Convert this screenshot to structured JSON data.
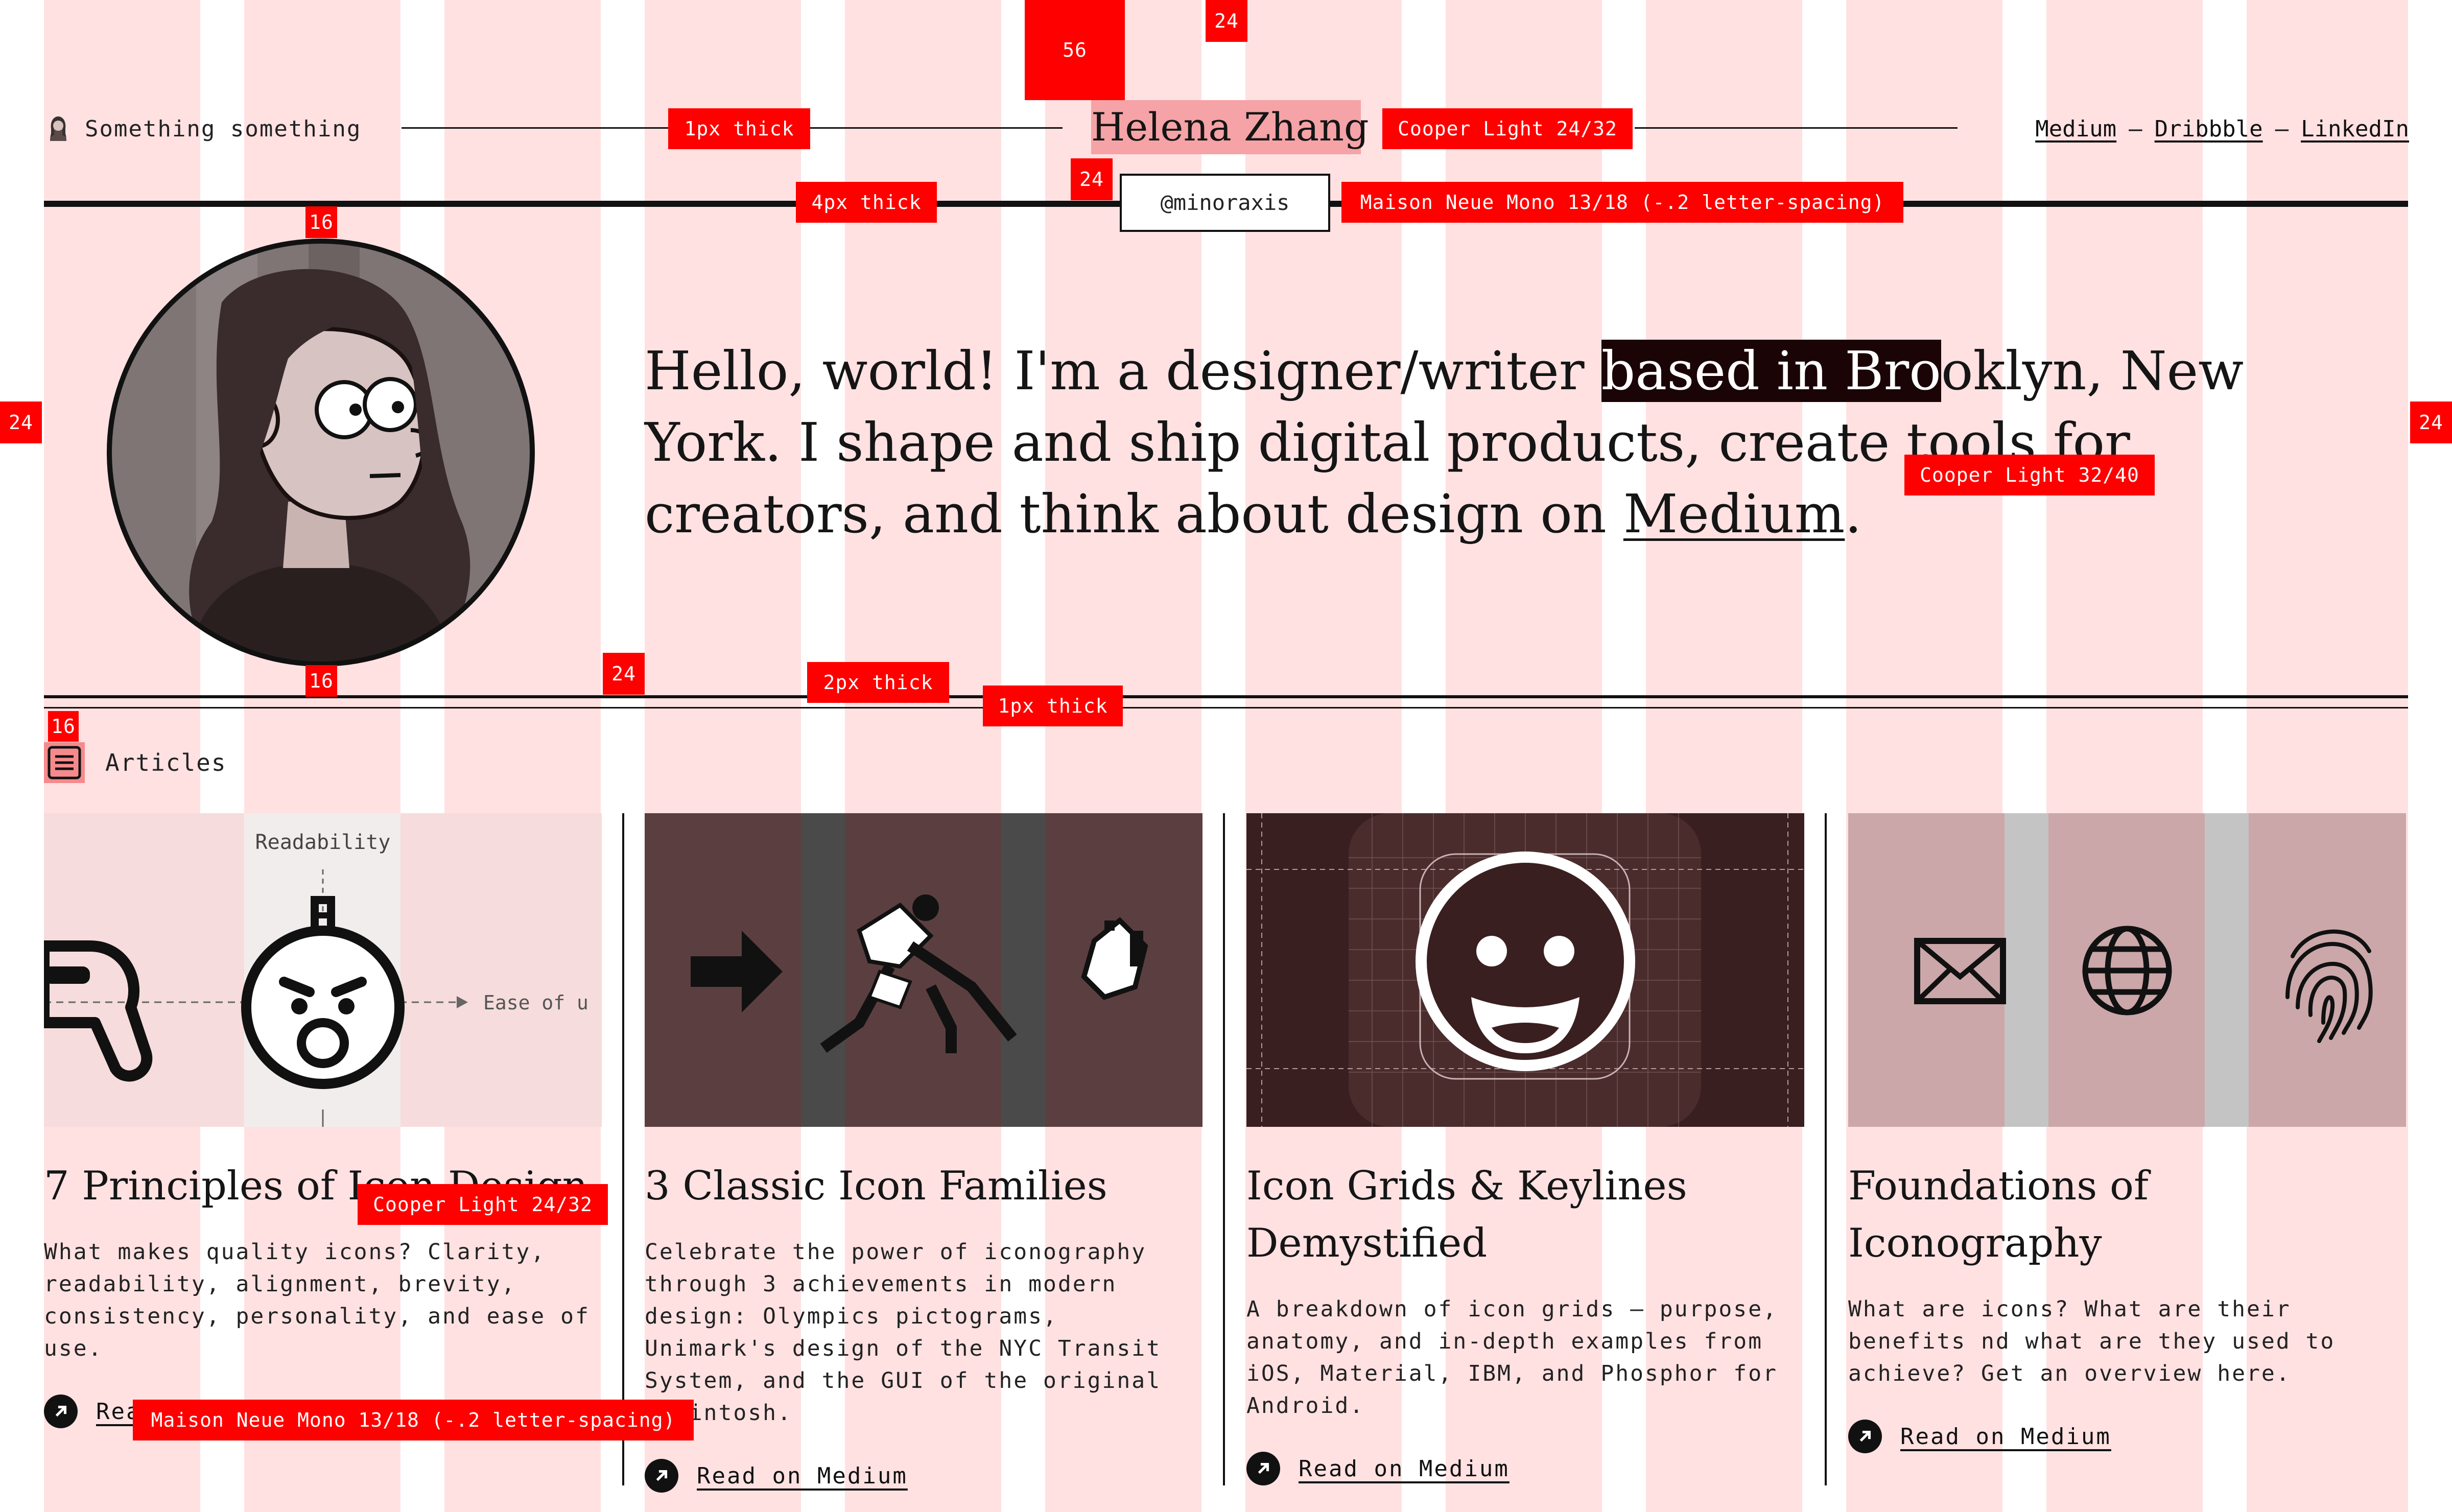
{
  "colors": {
    "grid_column": "#ffe1e2",
    "accent_red": "#ff0000",
    "title_highlight": "#f5a3a6",
    "ink": "#111111",
    "thumb_family": "#5b3f40",
    "thumb_grids": "#3a1f20",
    "thumb_foundations": "#cba7a9"
  },
  "header": {
    "brand_icon": "avatar-icon",
    "tagline": "Something something",
    "title": "Helena Zhang",
    "handle": "@minoraxis",
    "links": [
      "Medium",
      "Dribbble",
      "LinkedIn"
    ],
    "separator": "—"
  },
  "hero": {
    "intro_before": "Hello, world! I'm a designer/writer ",
    "intro_highlight": "based in Bro",
    "intro_middle": "oklyn, New York. I shape and ship digital products, create tools for creators, and think about design on ",
    "intro_link": "Medium",
    "intro_end": "."
  },
  "articles": {
    "heading": "Articles",
    "icon": "list-icon",
    "items": [
      {
        "title": "7 Principles of Icon Design",
        "description": "What makes quality icons? Clarity, readability, alignment, brevity, consistency, personality, and ease of use.",
        "link": "Read on Medium",
        "thumb_labels": [
          "Readability",
          "Ease of u"
        ]
      },
      {
        "title": "3 Classic Icon Families",
        "description": "Celebrate the power of iconography through 3 achievements in modern design: Olympics pictograms, Unimark's design of the NYC Transit System, and the GUI of the original Macintosh.",
        "link": "Read on Medium"
      },
      {
        "title": "Icon Grids & Keylines Demystified",
        "description": "A breakdown of icon grids — purpose, anatomy, and in-depth examples from iOS, Material, IBM, and Phosphor for Android.",
        "link": "Read on Medium"
      },
      {
        "title": "Foundations of Iconography",
        "description": "What are icons? What are their benefits nd what are they used to achieve? Get an overview here.",
        "link": "Read on Medium",
        "thumb_icons": [
          "envelope-icon",
          "globe-icon",
          "fingerprint-icon"
        ]
      }
    ]
  },
  "annotations": {
    "spacing_top_56": "56",
    "spacing_top_24": "24",
    "line_header": "1px thick",
    "font_title": "Cooper Light 24/32",
    "spacing_title_24": "24",
    "line_top": "4px thick",
    "font_handle": "Maison Neue Mono 13/18 (-.2 letter-spacing)",
    "spacing_avatar_top": "16",
    "margin_left": "24",
    "margin_right": "24",
    "font_hero": "Cooper Light 32/40",
    "spacing_avatar_bottom": "16",
    "spacing_section": "24",
    "line_lower": "2px thick",
    "line_lowest": "1px thick",
    "spacing_articles": "16",
    "font_card_title": "Cooper Light 24/32",
    "font_card_body": "Maison Neue Mono 13/18 (-.2 letter-spacing)"
  }
}
